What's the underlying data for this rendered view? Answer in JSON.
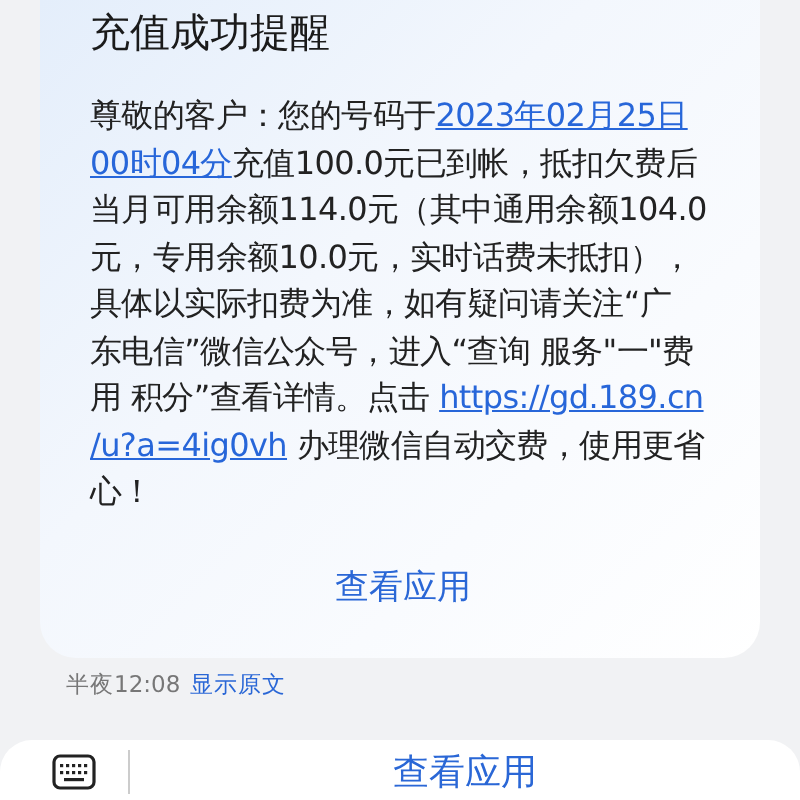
{
  "message": {
    "title": "充值成功提醒",
    "lines": [
      [
        {
          "kind": "text",
          "text": "尊敬的客户：您的号码于"
        },
        {
          "kind": "link",
          "text": "2023年02月25日"
        }
      ],
      [
        {
          "kind": "link",
          "text": "00时04分"
        },
        {
          "kind": "text",
          "text": "充值100.0元已到帐，抵扣欠费后"
        }
      ],
      [
        {
          "kind": "text",
          "text": "当月可用余额114.0元（其中通用余额104.0"
        }
      ],
      [
        {
          "kind": "text",
          "text": "元，专用余额10.0元，实时话费未抵扣），"
        }
      ],
      [
        {
          "kind": "text",
          "text": "具体以实际扣费为准，如有疑问请关注“广"
        }
      ],
      [
        {
          "kind": "text",
          "text": "东电信”微信公众号，进入“查询 服务\"一\"费"
        }
      ],
      [
        {
          "kind": "text",
          "text": "用 积分”查看详情。点击 "
        },
        {
          "kind": "link",
          "text": "https://gd.189.cn"
        }
      ],
      [
        {
          "kind": "link",
          "text": "/u?a=4ig0vh"
        },
        {
          "kind": "text",
          "text": " 办理微信自动交费，使用更省"
        }
      ],
      [
        {
          "kind": "text",
          "text": "心！"
        }
      ]
    ],
    "action": "查看应用"
  },
  "meta": {
    "time": "半夜12:08",
    "link": "显示原文"
  },
  "bottom_bar": {
    "action": "查看应用"
  }
}
